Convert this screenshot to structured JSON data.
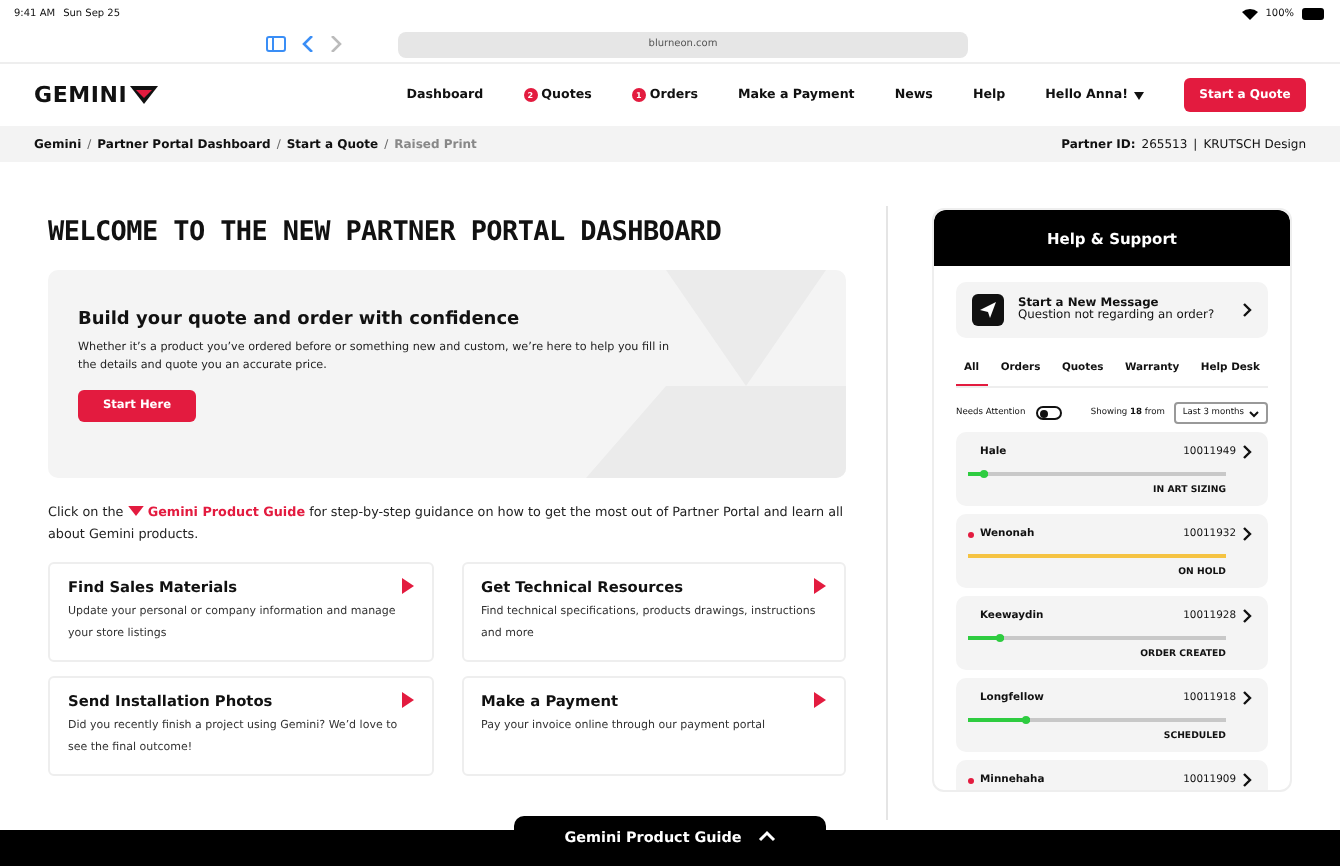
{
  "status_bar": {
    "time": "9:41 AM",
    "date": "Sun Sep 25",
    "battery": "100%"
  },
  "browser": {
    "url": "blurneon.com"
  },
  "nav": {
    "logo": "GEMINI",
    "items": [
      {
        "label": "Dashboard"
      },
      {
        "label": "Quotes",
        "badge": "2"
      },
      {
        "label": "Orders",
        "badge": "1"
      },
      {
        "label": "Make a Payment"
      },
      {
        "label": "News"
      },
      {
        "label": "Help"
      }
    ],
    "user": "Hello Anna!",
    "cta": "Start a Quote"
  },
  "breadcrumb": {
    "separator": "/",
    "divider": "|",
    "items": [
      {
        "label": "Gemini",
        "current": false
      },
      {
        "label": "Partner Portal Dashboard",
        "current": false
      },
      {
        "label": "Start a Quote",
        "current": false
      },
      {
        "label": "Raised Print",
        "current": true
      }
    ],
    "partner_label": "Partner ID:",
    "partner_id": "265513",
    "company": "KRUTSCH Design"
  },
  "title": "WELCOME TO THE NEW PARTNER PORTAL DASHBOARD",
  "hero": {
    "heading": "Build your quote and order with confidence",
    "text": "Whether it’s a product you’ve ordered before or something new and custom, we’re here to help you fill in the details and quote you an accurate price.",
    "button": "Start Here"
  },
  "guide_text": {
    "before": "Click on the",
    "link": "Gemini Product Guide",
    "after": "for step-by-step guidance on how to get the most out of Partner Portal and learn all about Gemini products."
  },
  "cards": [
    {
      "title": "Find Sales Materials",
      "text": "Update your personal or company information and manage your store listings"
    },
    {
      "title": "Get Technical Resources",
      "text": "Find technical specifications, products drawings, instructions and more"
    },
    {
      "title": "Send Installation Photos",
      "text": "Did you recently finish a project using Gemini? We’d love to see the final outcome!"
    },
    {
      "title": "Make a Payment",
      "text": "Pay your invoice online through our payment portal"
    }
  ],
  "help": {
    "title": "Help & Support",
    "message_title": "Start a New Message",
    "message_sub": "Question not regarding an order?",
    "tabs": [
      {
        "label": "All",
        "selected": true
      },
      {
        "label": "Orders",
        "selected": false
      },
      {
        "label": "Quotes",
        "selected": false
      },
      {
        "label": "Warranty",
        "selected": false
      },
      {
        "label": "Help Desk",
        "selected": false
      }
    ],
    "needs_attention_label": "Needs Attention",
    "needs_attention_on": false,
    "showing_before": "Showing",
    "showing_count": "18",
    "showing_after": "from",
    "range": "Last 3 months",
    "orders": [
      {
        "name": "Hale",
        "number": "10011949",
        "attention": false,
        "level": 0.08,
        "color": "#2ecc40",
        "status": "IN ART SIZING"
      },
      {
        "name": "Wenonah",
        "number": "10011932",
        "attention": true,
        "level": 1,
        "color": "#f5c342",
        "status": "ON HOLD"
      },
      {
        "name": "Keewaydin",
        "number": "10011928",
        "attention": false,
        "level": 0.14,
        "color": "#2ecc40",
        "status": "ORDER CREATED"
      },
      {
        "name": "Longfellow",
        "number": "10011918",
        "attention": false,
        "level": 0.24,
        "color": "#2ecc40",
        "status": "SCHEDULED"
      },
      {
        "name": "Minnehaha",
        "number": "10011909",
        "attention": true
      }
    ]
  },
  "guide_tab": "Gemini Product Guide"
}
